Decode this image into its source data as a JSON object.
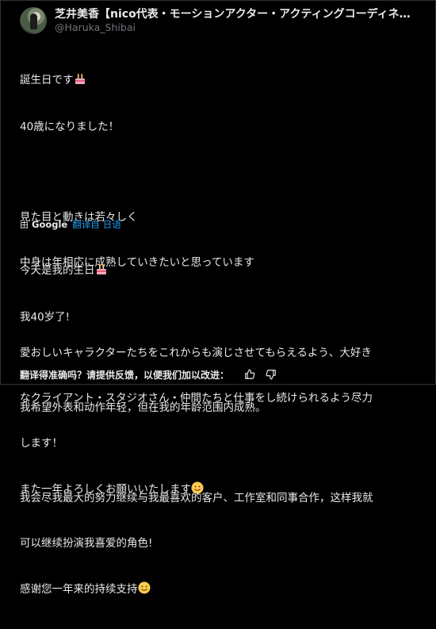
{
  "author": {
    "display_name": "芝井美香【nico代表・モーションアクター・アクティングコーディネ...",
    "handle": "@Haruka_Shibai",
    "avatar_icon": "avatar-photo"
  },
  "original": {
    "lines": [
      "誕生日です",
      "40歳になりました！",
      "",
      "見た目と動きは若々しく",
      "中身は年相応に成熟していきたいと思っています",
      "",
      "愛おしいキャラクターたちをこれからも演じさせてもらえるよう、大好き",
      "なクライアント・スタジオさん・仲間たちと仕事をし続けられるよう尽力",
      "します！",
      "また一年よろしくお願いいたします"
    ]
  },
  "translation": {
    "by_label": "由",
    "provider": "Google",
    "translated_from_label": "翻译自",
    "source_language": "日语",
    "lines": [
      "今天是我的生日",
      "我40岁了!",
      "",
      "我希望外表和动作年轻，但在我的年龄范围内成熟。",
      "",
      "我会尽我最大的努力继续与我最喜欢的客户、工作室和同事合作，这样我就",
      "可以继续扮演我喜爱的角色!",
      "感谢您一年来的持续支持"
    ]
  },
  "feedback": {
    "prompt": "翻译得准确吗？请提供反馈，以便我们加以改进：",
    "thumbs_up_icon": "thumbs-up-icon",
    "thumbs_down_icon": "thumbs-down-icon"
  },
  "colors": {
    "background": "#000000",
    "text": "#e7e9ea",
    "muted": "#71767b",
    "link": "#1d9bf0",
    "border": "#2f3336"
  }
}
